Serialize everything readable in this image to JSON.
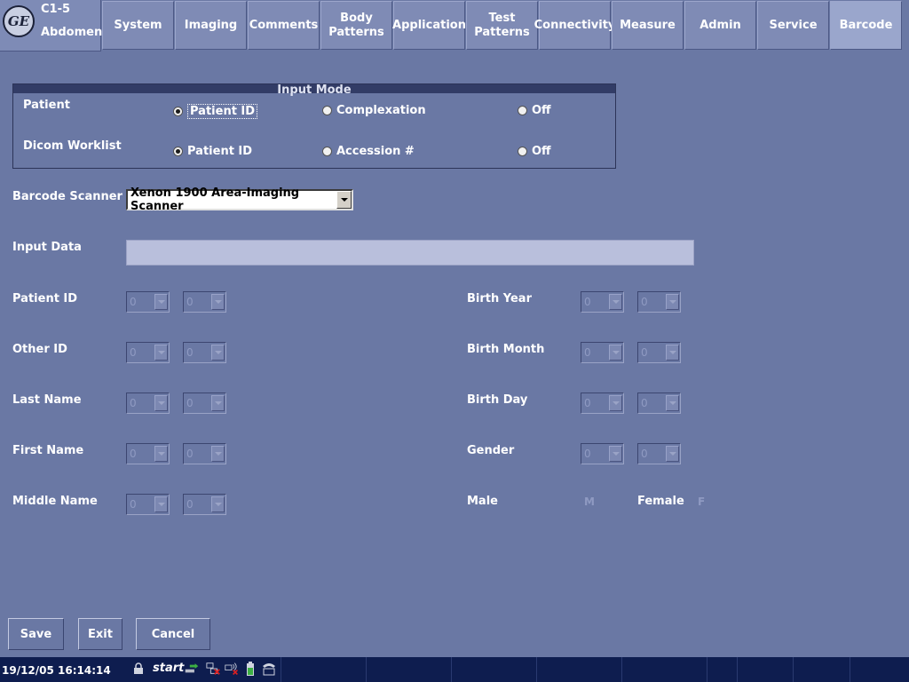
{
  "header": {
    "logo_text": "GE",
    "probe": "C1-5",
    "application": "Abdomen"
  },
  "tabs": [
    {
      "label": "System",
      "active": false
    },
    {
      "label": "Imaging",
      "active": false
    },
    {
      "label": "Comments",
      "active": false
    },
    {
      "label": "Body\nPatterns",
      "active": false
    },
    {
      "label": "Application",
      "active": false
    },
    {
      "label": "Test\nPatterns",
      "active": false
    },
    {
      "label": "Connectivity",
      "active": false
    },
    {
      "label": "Measure",
      "active": false
    },
    {
      "label": "Admin",
      "active": false
    },
    {
      "label": "Service",
      "active": false
    },
    {
      "label": "Barcode",
      "active": true
    }
  ],
  "input_mode": {
    "title": "Input Mode",
    "patient": {
      "label": "Patient",
      "options": [
        "Patient ID",
        "Complexation",
        "Off"
      ],
      "selected": "Patient ID"
    },
    "dicom": {
      "label": "Dicom Worklist",
      "options": [
        "Patient ID",
        "Accession #",
        "Off"
      ],
      "selected": "Patient ID"
    }
  },
  "scanner": {
    "label": "Barcode Scanner",
    "value": "Xenon 1900 Area-Imaging Scanner"
  },
  "input_data": {
    "label": "Input Data",
    "value": ""
  },
  "fields_left": [
    {
      "label": "Patient ID",
      "start": "0",
      "length": "0"
    },
    {
      "label": "Other ID",
      "start": "0",
      "length": "0"
    },
    {
      "label": "Last Name",
      "start": "0",
      "length": "0"
    },
    {
      "label": "First Name",
      "start": "0",
      "length": "0"
    },
    {
      "label": "Middle Name",
      "start": "0",
      "length": "0"
    }
  ],
  "fields_right": [
    {
      "label": "Birth Year",
      "start": "0",
      "length": "0"
    },
    {
      "label": "Birth Month",
      "start": "0",
      "length": "0"
    },
    {
      "label": "Birth Day",
      "start": "0",
      "length": "0"
    },
    {
      "label": "Gender",
      "start": "0",
      "length": "0"
    }
  ],
  "gender_codes": {
    "male_label": "Male",
    "male_value": "M",
    "female_label": "Female",
    "female_value": "F"
  },
  "buttons": {
    "save": "Save",
    "exit": "Exit",
    "cancel": "Cancel"
  },
  "taskbar": {
    "clock": "19/12/05 16:14:14",
    "start": "start",
    "icons": [
      "lock-icon",
      "network-arrow-icon",
      "network-disconnected-icon",
      "wireless-disconnected-icon",
      "battery-icon",
      "ge-phone-icon"
    ]
  }
}
